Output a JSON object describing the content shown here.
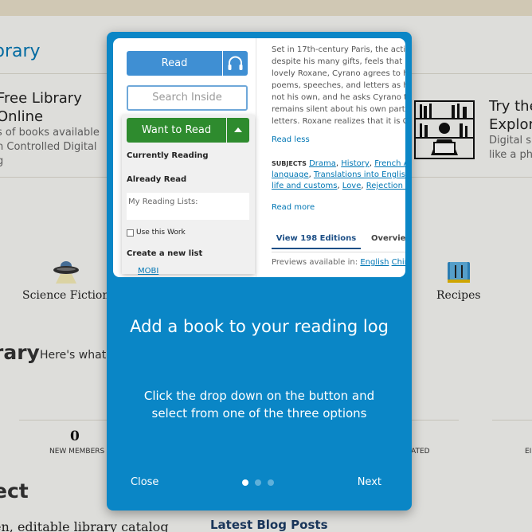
{
  "background": {
    "brand": "brary",
    "free_library": {
      "title_lines": [
        "Free Library",
        "Online"
      ],
      "desc_lines": [
        "s of books available",
        "n Controlled Digital",
        "g"
      ]
    },
    "try_the": {
      "title_lines": [
        "Try the",
        "Explore"
      ],
      "desc_lines": [
        "Digital sh",
        "like a phy"
      ]
    },
    "categories": [
      {
        "label": "Science Fiction",
        "icon": "ufo-icon"
      },
      {
        "label": "Recipes",
        "icon": "cookbook-icon"
      }
    ],
    "library_heading": "rary",
    "library_sub": "Here's what's",
    "stats": {
      "value": "0",
      "labels": [
        "NEW MEMBERS",
        "ATED",
        "EI"
      ]
    },
    "collect_heading": "ect",
    "catalog_text": "en, editable library catalog",
    "blog_heading": "Latest Blog Posts"
  },
  "modal": {
    "screenshot": {
      "read_label": "Read",
      "listen_icon": "headphones-icon",
      "search_placeholder": "Search Inside",
      "want_to_read": "Want to Read",
      "dropdown_items": {
        "currently_reading": "Currently Reading",
        "already_read": "Already Read",
        "my_reading_lists": "My Reading Lists:",
        "use_this_work": "Use this Work",
        "create_list": "Create a new list"
      },
      "mobi_link": "MOBI",
      "description_lines": [
        "Set in 17th-century Paris, the acti",
        "despite his many gifts, feels that n",
        "lovely Roxane, Cyrano agrees to h",
        "poems, speeches, and letters as h",
        "not his own, and he asks Cyrano to",
        "remains silent about his own part i",
        "letters. Roxane realizes that it is Cy"
      ],
      "read_less": "Read less",
      "subjects_label": "SUBJECTS",
      "subjects": [
        "Drama",
        "History",
        "French Auth",
        "language",
        "Translations into English",
        "life and customs",
        "Love",
        "Rejection (Ps"
      ],
      "read_more": "Read more",
      "tab_editions": "View 198 Editions",
      "tab_overview": "Overvie",
      "previews_label": "Previews available in:",
      "preview_langs": [
        "English",
        "Chine"
      ]
    },
    "title": "Add a book to your reading log",
    "body": "Click the drop down on the button and select from one of the three options",
    "close_label": "Close",
    "next_label": "Next",
    "step_current": 1,
    "step_total": 3
  }
}
